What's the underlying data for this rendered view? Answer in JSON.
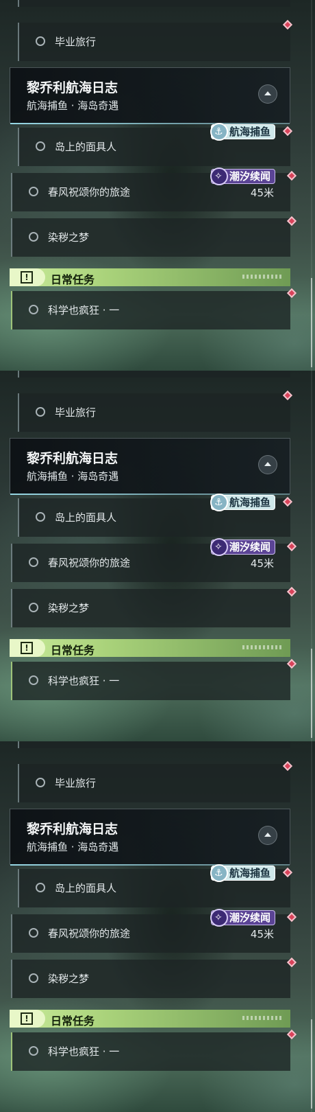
{
  "panels": [
    {
      "previous_item": {
        "label": "毕业旅行"
      },
      "header": {
        "title": "黎乔利航海日志",
        "subtitle": "航海捕鱼 · 海岛奇遇"
      },
      "tasks": [
        {
          "label": "岛上的面具人",
          "badge": "航海捕鱼"
        },
        {
          "label": "春风祝颂你的旅途",
          "badge": "潮汐续闻",
          "distance": "45米"
        },
        {
          "label": "染秽之梦"
        }
      ],
      "daily": {
        "label": "日常任务",
        "tasks": [
          {
            "label": "科学也疯狂 · 一"
          }
        ]
      }
    },
    {
      "previous_item": {
        "label": "毕业旅行"
      },
      "header": {
        "title": "黎乔利航海日志",
        "subtitle": "航海捕鱼 · 海岛奇遇"
      },
      "tasks": [
        {
          "label": "岛上的面具人",
          "badge": "航海捕鱼"
        },
        {
          "label": "春风祝颂你的旅途",
          "badge": "潮汐续闻",
          "distance": "45米"
        },
        {
          "label": "染秽之梦"
        }
      ],
      "daily": {
        "label": "日常任务",
        "tasks": [
          {
            "label": "科学也疯狂 · 一"
          }
        ]
      }
    },
    {
      "previous_item": {
        "label": "毕业旅行"
      },
      "header": {
        "title": "黎乔利航海日志",
        "subtitle": "航海捕鱼 · 海岛奇遇"
      },
      "tasks": [
        {
          "label": "岛上的面具人",
          "badge": "航海捕鱼"
        },
        {
          "label": "春风祝颂你的旅途",
          "badge": "潮汐续闻",
          "distance": "45米"
        },
        {
          "label": "染秽之梦"
        }
      ],
      "daily": {
        "label": "日常任务",
        "tasks": [
          {
            "label": "科学也疯狂 · 一"
          }
        ]
      }
    }
  ],
  "colors": {
    "marker": "#d9435a",
    "daily_accent": "#a9d27a",
    "tide_badge": "#5b4495",
    "fishing_badge": "#cfe8ea"
  },
  "icons": {
    "task_status": "circle-icon",
    "map_marker": "diamond-marker-icon",
    "collapse": "chevron-up-icon",
    "daily": "exclamation-icon"
  }
}
